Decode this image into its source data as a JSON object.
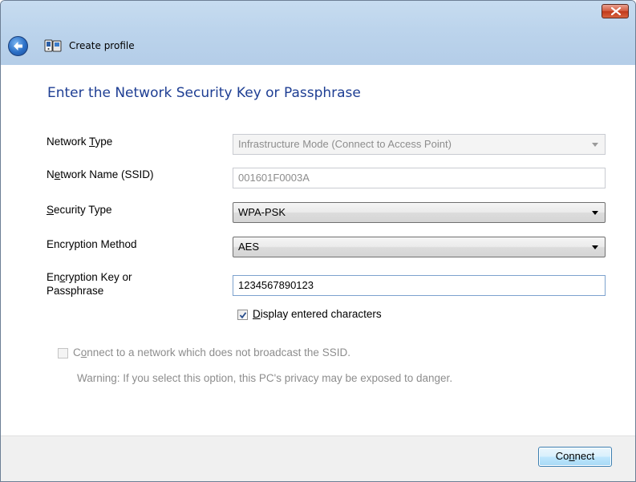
{
  "window": {
    "title": "Create profile"
  },
  "page": {
    "heading": "Enter the Network Security Key or Passphrase"
  },
  "form": {
    "network_type": {
      "label_pre": "Network ",
      "label_accel": "T",
      "label_post": "ype",
      "value": "Infrastructure Mode (Connect to Access Point)"
    },
    "network_name": {
      "label_pre": "N",
      "label_accel": "e",
      "label_post": "twork Name (SSID)",
      "value": "001601F0003A"
    },
    "security_type": {
      "label_pre": "",
      "label_accel": "S",
      "label_post": "ecurity Type",
      "value": "WPA-PSK"
    },
    "encryption_method": {
      "label": "Encryption Method",
      "value": "AES"
    },
    "encryption_key": {
      "label_pre": "En",
      "label_accel": "c",
      "label_post": "ryption Key or",
      "label_line2": "Passphrase",
      "value": "1234567890123"
    },
    "display_chars": {
      "label_pre": "",
      "label_accel": "D",
      "label_post": "isplay entered characters",
      "checked": true
    },
    "hidden_ssid": {
      "label_pre": "C",
      "label_accel": "o",
      "label_post": "nnect to a network which does not broadcast the SSID.",
      "checked": false,
      "warning": "Warning: If you select this option, this PC's privacy may be exposed to danger."
    }
  },
  "footer": {
    "connect_pre": "Co",
    "connect_accel": "n",
    "connect_post": "nect"
  },
  "colors": {
    "heading": "#1e3e93",
    "titlebar": "#bcd4ec",
    "footer": "#f0f0f0"
  }
}
